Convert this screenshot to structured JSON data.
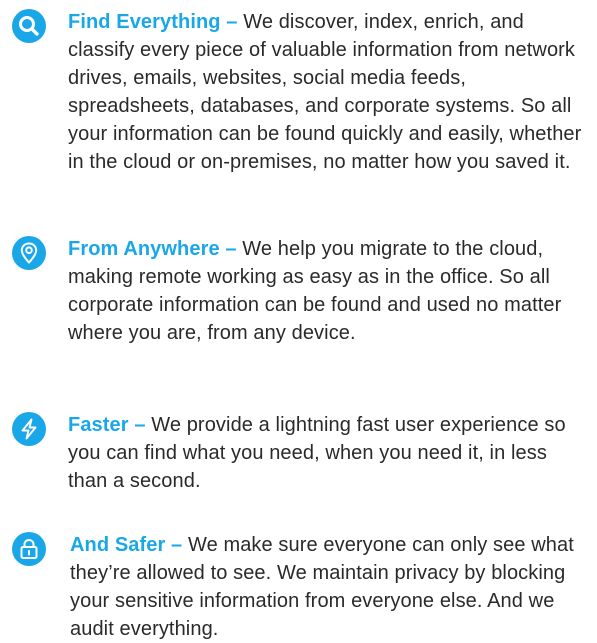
{
  "colors": {
    "accent": "#1aa7e8",
    "text": "#2a2a2a",
    "background": "#ffffff"
  },
  "features": [
    {
      "icon": "search-icon",
      "title": "Find Everything",
      "separator": "–",
      "body": "We discover, index, enrich, and classify every piece of valuable information from network drives, emails, websites, social media feeds, spreadsheets, databases, and corporate systems. So all your information can be found quickly and easily, whether in the cloud or on-premises, no matter how you saved it."
    },
    {
      "icon": "location-pin-icon",
      "title": "From Anywhere",
      "separator": "–",
      "body": "We help you migrate to the cloud, making remote working as easy as in the office. So all corporate information can be found and used no matter where you are, from any device."
    },
    {
      "icon": "lightning-icon",
      "title": "Faster",
      "separator": "–",
      "body": "We provide a lightning fast user experience so you can find what you need, when you need it, in less than a second."
    },
    {
      "icon": "lock-icon",
      "title": "And Safer",
      "separator": "–",
      "body": "We make sure everyone can only see what they’re allowed to see. We maintain privacy by blocking your sensitive information from everyone else. And we audit everything."
    }
  ]
}
